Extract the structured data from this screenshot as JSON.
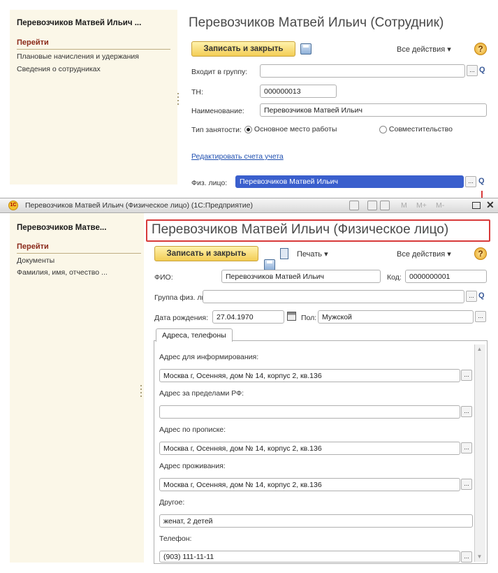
{
  "employee": {
    "nav": {
      "title": "Перевозчиков Матвей Ильич ...",
      "section": "Перейти",
      "links": [
        "Плановые начисления и удержания",
        "Сведения о сотрудниках"
      ]
    },
    "title": "Перевозчиков Матвей Ильич (Сотрудник)",
    "toolbar": {
      "save_close": "Записать и закрыть",
      "all_actions": "Все действия ▾",
      "help": "?"
    },
    "group_label": "Входит в группу:",
    "group_value": "",
    "tn_label": "ТН:",
    "tn_value": "000000013",
    "name_label": "Наименование:",
    "name_value": "Перевозчиков Матвей Ильич",
    "employment_label": "Тип занятости:",
    "employment_options": [
      "Основное место работы",
      "Совместительство"
    ],
    "accounts_link": "Редактировать счета учета",
    "person_label": "Физ. лицо:",
    "person_value": "Перевозчиков Матвей Ильич"
  },
  "window": {
    "title": "Перевозчиков Матвей Ильич (Физическое лицо)  (1С:Предприятие)",
    "controls": [
      "M",
      "M+",
      "M-"
    ]
  },
  "person": {
    "nav": {
      "title": "Перевозчиков Матве...",
      "section": "Перейти",
      "links": [
        "Документы",
        "Фамилия, имя, отчество ..."
      ]
    },
    "title": "Перевозчиков Матвей Ильич (Физическое лицо)",
    "toolbar": {
      "save_close": "Записать и закрыть",
      "print": "Печать ▾",
      "all_actions": "Все действия ▾",
      "help": "?"
    },
    "fio_label": "ФИО:",
    "fio_value": "Перевозчиков Матвей Ильич",
    "code_label": "Код:",
    "code_value": "0000000001",
    "group_label": "Группа физ. лиц:",
    "group_value": "",
    "dob_label": "Дата рождения:",
    "dob_value": "27.04.1970",
    "sex_label": "Пол:",
    "sex_value": "Мужской",
    "tab": "Адреса, телефоны",
    "addresses": [
      {
        "label": "Адрес для информирования:",
        "value": "Москва г, Осенняя, дом № 14, корпус 2, кв.136",
        "dots": true
      },
      {
        "label": "Адрес за пределами РФ:",
        "value": "",
        "dots": true
      },
      {
        "label": "Адрес по прописке:",
        "value": "Москва г, Осенняя, дом № 14, корпус 2, кв.136",
        "dots": true
      },
      {
        "label": "Адрес проживания:",
        "value": "Москва г, Осенняя, дом № 14, корпус 2, кв.136",
        "dots": true
      },
      {
        "label": "Другое:",
        "value": "женат, 2 детей",
        "dots": false
      },
      {
        "label": "Телефон:",
        "value": "(903) 111-11-11",
        "dots": true
      }
    ]
  }
}
